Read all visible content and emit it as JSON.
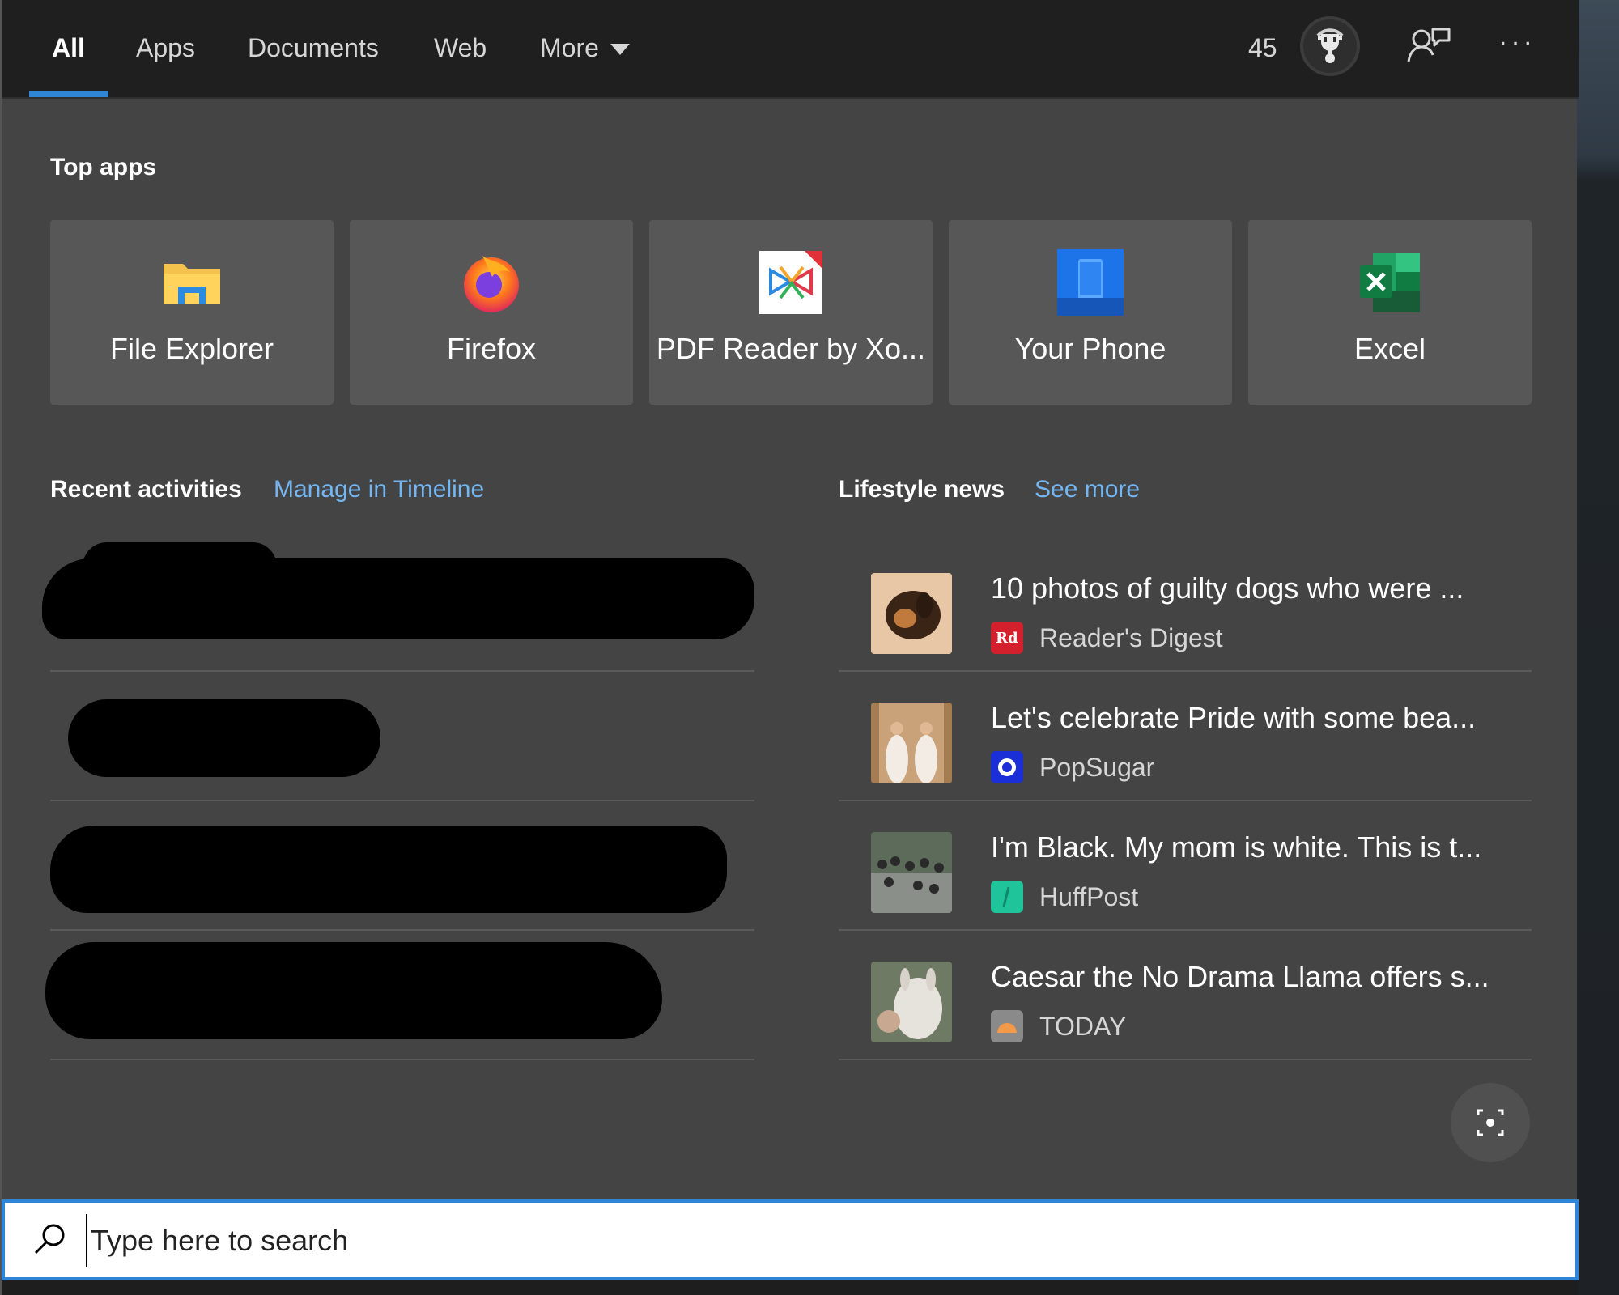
{
  "tabs": [
    {
      "label": "All",
      "active": true
    },
    {
      "label": "Apps"
    },
    {
      "label": "Documents"
    },
    {
      "label": "Web"
    },
    {
      "label": "More"
    }
  ],
  "header": {
    "points": "45",
    "icons": [
      "trophy-icon",
      "feedback-icon",
      "more-options-icon"
    ],
    "more_options": "···"
  },
  "top_apps": {
    "title": "Top apps",
    "items": [
      {
        "label": "File Explorer",
        "icon": "folder-icon"
      },
      {
        "label": "Firefox",
        "icon": "firefox-icon"
      },
      {
        "label": "PDF Reader by Xo...",
        "icon": "pdf-reader-icon"
      },
      {
        "label": "Your Phone",
        "icon": "phone-icon"
      },
      {
        "label": "Excel",
        "icon": "excel-icon"
      }
    ]
  },
  "recent": {
    "title": "Recent activities",
    "link": "Manage in Timeline"
  },
  "news": {
    "title": "Lifestyle news",
    "link": "See more",
    "items": [
      {
        "title": "10 photos of guilty dogs who were ...",
        "source": "Reader's Digest",
        "source_color": "#d4202c"
      },
      {
        "title": "Let's celebrate Pride with some bea...",
        "source": "PopSugar",
        "source_color": "#1a2fd8"
      },
      {
        "title": "I'm Black. My mom is white. This is t...",
        "source": "HuffPost",
        "source_color": "#1fc49a"
      },
      {
        "title": "Caesar the No Drama Llama offers s...",
        "source": "TODAY",
        "source_color": "#8a8a8a"
      }
    ]
  },
  "search": {
    "placeholder": "Type here to search"
  },
  "colors": {
    "accent": "#2f86d6",
    "link": "#74b6f1",
    "panel": "#444444",
    "topbar": "#1f1f1f",
    "tile": "#575757"
  }
}
